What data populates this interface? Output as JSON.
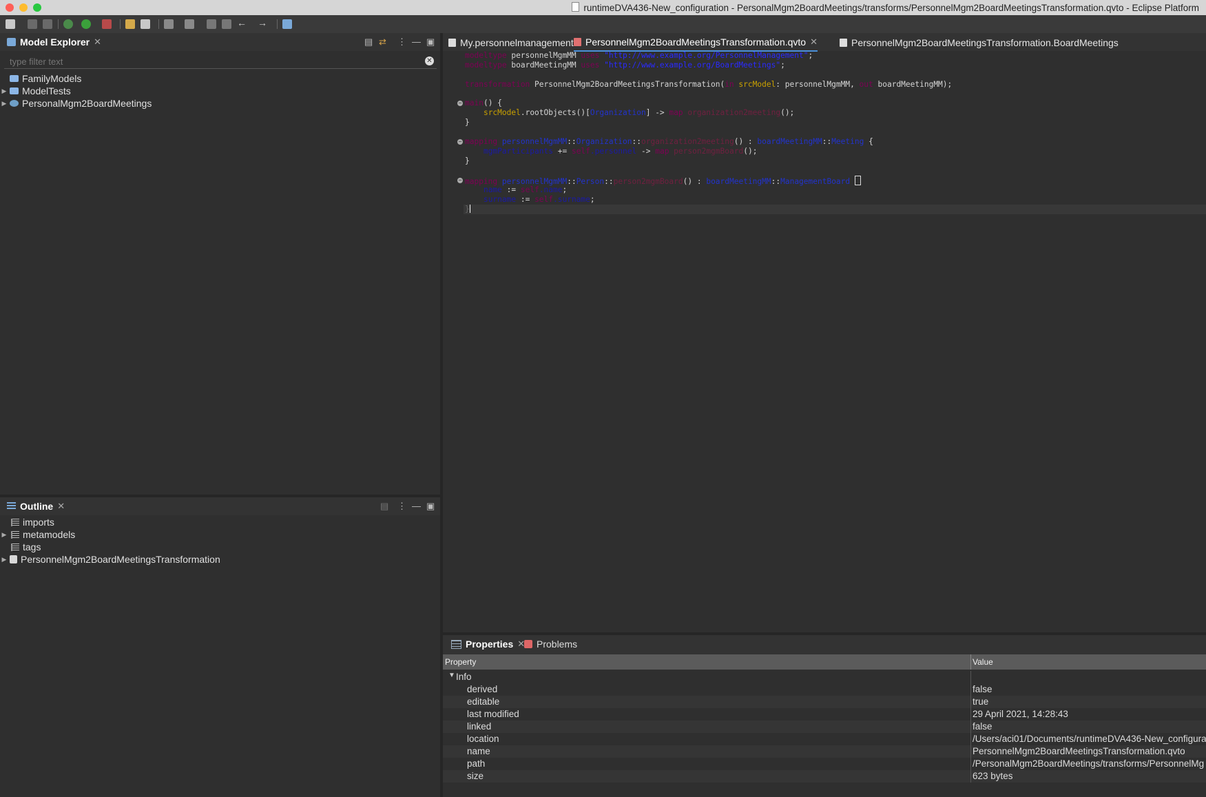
{
  "window": {
    "title": "runtimeDVA436-New_configuration - PersonalMgm2BoardMeetings/transforms/PersonnelMgm2BoardMeetingsTransformation.qvto - Eclipse Platform"
  },
  "model_explorer": {
    "tab_label": "Model Explorer",
    "filter_placeholder": "type filter text",
    "items": [
      {
        "label": "FamilyModels",
        "expandable": false
      },
      {
        "label": "ModelTests",
        "expandable": true
      },
      {
        "label": "PersonalMgm2BoardMeetings",
        "expandable": true
      }
    ]
  },
  "outline": {
    "tab_label": "Outline",
    "items": [
      {
        "label": "imports",
        "expandable": false
      },
      {
        "label": "metamodels",
        "expandable": true
      },
      {
        "label": "tags",
        "expandable": false
      },
      {
        "label": "PersonnelMgm2BoardMeetingsTransformation",
        "expandable": true
      }
    ]
  },
  "editor": {
    "tabs": [
      {
        "label": "My.personnelmanagement",
        "active": false
      },
      {
        "label": "PersonnelMgm2BoardMeetingsTransformation.qvto",
        "active": true
      },
      {
        "label": "PersonnelMgm2BoardMeetingsTransformation.BoardMeetings",
        "active": false
      }
    ],
    "code": {
      "l1_kw": "modeltype",
      "l1_name": " personnelMgmMM ",
      "l1_uses": "uses",
      "l1_uri": "\"http://www.example.org/PersonnelManagement\"",
      "l1_end": ";",
      "l2_kw": "modeltype",
      "l2_name": " boardMeetingMM ",
      "l2_uses": "uses",
      "l2_uri": "\"http://www.example.org/BoardMeetings\"",
      "l2_end": ";",
      "l3_kw": "transformation",
      "l3_name": " PersonnelMgm2BoardMeetingsTransformation(",
      "l3_in": "in",
      "l3_src": " srcModel",
      "l3_mid": ": personnelMgmMM, ",
      "l3_out": "out",
      "l3_end": " boardMeetingMM);",
      "l4_kw": "main",
      "l4_end": "() {",
      "l5_var": "srcModel",
      "l5_call": ".rootObjects()[",
      "l5_type": "Organization",
      "l5_arrow": "] -> ",
      "l5_map": "map",
      "l5_fn": " organization2meeting",
      "l5_end": "();",
      "l6": "}",
      "l7_kw": "mapping",
      "l7_mm": " personnelMgmMM",
      "l7_sep": "::",
      "l7_type": "Organization",
      "l7_sep2": "::",
      "l7_fn": "organization2meeting",
      "l7_mid": "() : ",
      "l7_mm2": "boardMeetingMM",
      "l7_sep3": "::",
      "l7_type2": "Meeting",
      "l7_end": " {",
      "l8_prop": "mgmParticipants",
      "l8_op": " += ",
      "l8_self": "self",
      "l8_field": ".personnel",
      "l8_arrow": " -> ",
      "l8_map": "map",
      "l8_fn": " person2mgmBoard",
      "l8_end": "();",
      "l9": "}",
      "l10_kw": "mapping",
      "l10_mm": " personnelMgmMM",
      "l10_sep": "::",
      "l10_type": "Person",
      "l10_sep2": "::",
      "l10_fn": "person2mgmBoard",
      "l10_mid": "() : ",
      "l10_mm2": "boardMeetingMM",
      "l10_sep3": "::",
      "l10_type2": "ManagementBoard",
      "l10_end": " ",
      "l11_prop": "name",
      "l11_op": " := ",
      "l11_self": "self",
      "l11_field": ".name",
      "l11_end": ";",
      "l12_prop": "surname",
      "l12_op": " := ",
      "l12_self": "self",
      "l12_field": ".surname",
      "l12_end": ";",
      "l13": "}"
    }
  },
  "properties": {
    "tab_label": "Properties",
    "other_tab": "Problems",
    "col_property": "Property",
    "col_value": "Value",
    "group": "Info",
    "rows": [
      {
        "name": "derived",
        "value": "false"
      },
      {
        "name": "editable",
        "value": "true"
      },
      {
        "name": "last modified",
        "value": "29 April 2021, 14:28:43"
      },
      {
        "name": "linked",
        "value": "false"
      },
      {
        "name": "location",
        "value": "/Users/aci01/Documents/runtimeDVA436-New_configura"
      },
      {
        "name": "name",
        "value": "PersonnelMgm2BoardMeetingsTransformation.qvto"
      },
      {
        "name": "path",
        "value": "/PersonalMgm2BoardMeetings/transforms/PersonnelMg"
      },
      {
        "name": "size",
        "value": "623  bytes"
      }
    ]
  },
  "colors": {
    "accent": "#4a90d9",
    "bg": "#2f2f2f",
    "header": "#5b5b5b"
  }
}
